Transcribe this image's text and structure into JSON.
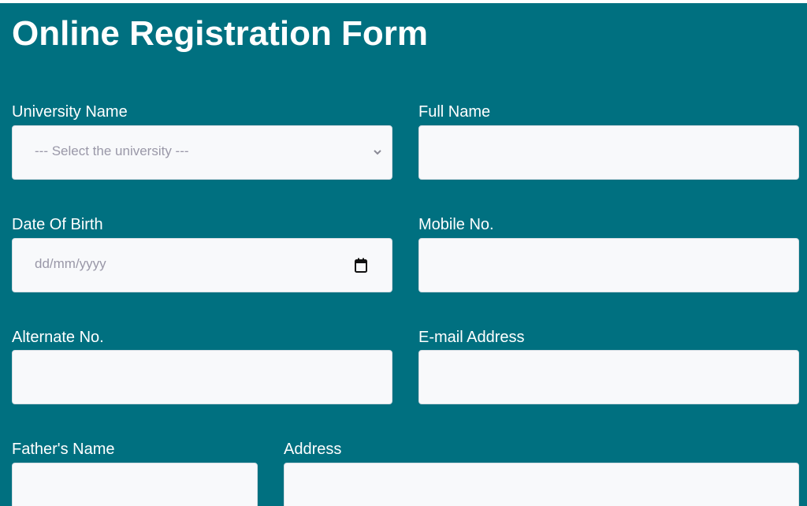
{
  "form": {
    "title": "Online Registration Form",
    "fields": {
      "university": {
        "label": "University Name",
        "placeholder": "--- Select the university ---"
      },
      "full_name": {
        "label": "Full Name",
        "value": ""
      },
      "dob": {
        "label": "Date Of Birth",
        "placeholder": "dd/mm/yyyy"
      },
      "mobile": {
        "label": "Mobile No.",
        "value": ""
      },
      "alternate": {
        "label": "Alternate No.",
        "value": ""
      },
      "email": {
        "label": "E-mail Address",
        "value": ""
      },
      "father_name": {
        "label": "Father's Name",
        "value": ""
      },
      "address": {
        "label": "Address",
        "value": ""
      }
    }
  },
  "icons": {
    "select_arrow": "chevron-down-icon",
    "date_picker": "calendar-icon"
  },
  "colors": {
    "background": "#007080",
    "input_background": "#f8f9fb",
    "label_text": "#ffffff",
    "placeholder_text": "#9a98a8"
  }
}
